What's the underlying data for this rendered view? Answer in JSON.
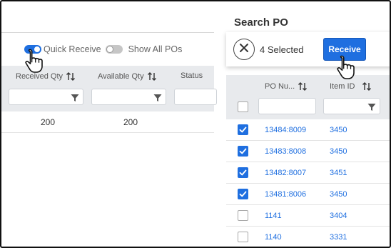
{
  "left_panel": {
    "toggles": [
      {
        "label": "Quick Receive",
        "on": true
      },
      {
        "label": "Show All POs",
        "on": false
      }
    ],
    "columns": [
      "Received Qty",
      "Available Qty",
      "Status"
    ],
    "rows": [
      {
        "received_qty": "200",
        "available_qty": "200",
        "status": ""
      }
    ]
  },
  "right_panel": {
    "title": "Search PO",
    "selected_text": "4 Selected",
    "receive_label": "Receive",
    "columns": [
      "PO Nu...",
      "Item ID"
    ],
    "rows": [
      {
        "po": "13484:8009",
        "item": "3450",
        "checked": true
      },
      {
        "po": "13483:8008",
        "item": "3450",
        "checked": true
      },
      {
        "po": "13482:8007",
        "item": "3451",
        "checked": true
      },
      {
        "po": "13481:8006",
        "item": "3450",
        "checked": true
      },
      {
        "po": "1141",
        "item": "3404",
        "checked": false
      },
      {
        "po": "1140",
        "item": "3331",
        "checked": false
      }
    ]
  },
  "colors": {
    "accent": "#1f6fe0",
    "header_bg": "#e8eaed",
    "link": "#1f6fe0"
  },
  "icons": [
    "sort-icon",
    "filter-icon",
    "close-icon",
    "check-icon",
    "hand-pointer-icon"
  ]
}
